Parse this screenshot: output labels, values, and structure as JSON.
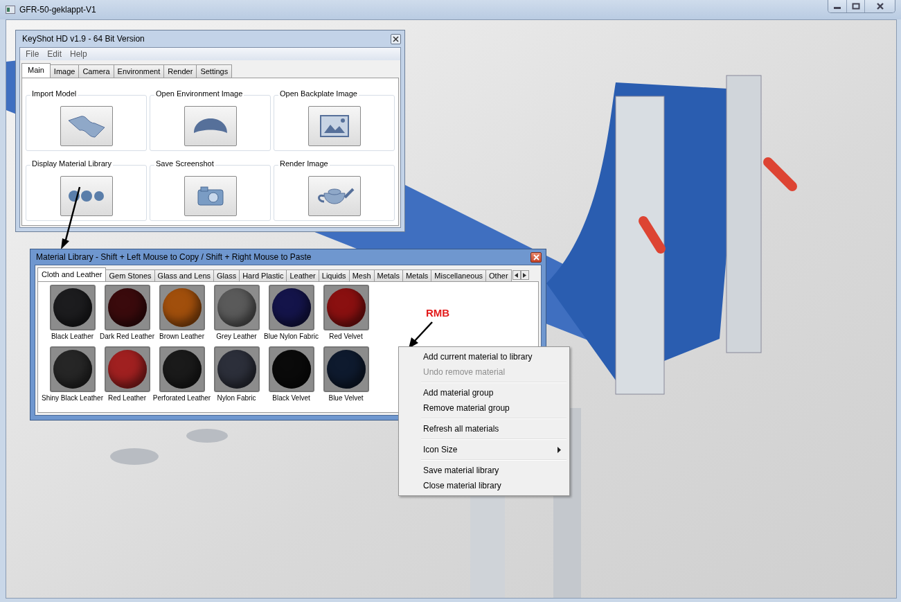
{
  "window": {
    "title": "GFR-50-geklappt-V1"
  },
  "keyshot_window": {
    "title": "KeyShot HD v1.9 - 64 Bit Version",
    "menu": [
      "File",
      "Edit",
      "Help"
    ],
    "tabs": [
      {
        "label": "Main",
        "selected": true
      },
      {
        "label": "Image",
        "selected": false
      },
      {
        "label": "Camera",
        "selected": false
      },
      {
        "label": "Environment",
        "selected": false
      },
      {
        "label": "Render",
        "selected": false
      },
      {
        "label": "Settings",
        "selected": false
      }
    ],
    "actions": [
      {
        "label": "Import Model",
        "kind": "surface"
      },
      {
        "label": "Open Environment Image",
        "kind": "dome"
      },
      {
        "label": "Open Backplate Image",
        "kind": "picture"
      },
      {
        "label": "Display Material Library",
        "kind": "spheres"
      },
      {
        "label": "Save Screenshot",
        "kind": "camera"
      },
      {
        "label": "Render Image",
        "kind": "teapot"
      }
    ]
  },
  "material_library": {
    "title": "Material Library - Shift + Left Mouse to Copy / Shift + Right Mouse to Paste",
    "tabs": [
      {
        "label": "Cloth and Leather",
        "selected": true
      },
      {
        "label": "Gem Stones",
        "selected": false
      },
      {
        "label": "Glass and Lens",
        "selected": false
      },
      {
        "label": "Glass",
        "selected": false
      },
      {
        "label": "Hard Plastic",
        "selected": false
      },
      {
        "label": "Leather",
        "selected": false
      },
      {
        "label": "Liquids",
        "selected": false
      },
      {
        "label": "Mesh",
        "selected": false
      },
      {
        "label": "Metals",
        "selected": false
      },
      {
        "label": "Metals",
        "selected": false
      },
      {
        "label": "Miscellaneous",
        "selected": false
      },
      {
        "label": "Other",
        "selected": false
      }
    ],
    "materials": [
      {
        "name": "Black Leather",
        "color": "#1c1c1e"
      },
      {
        "name": "Dark Red Leather",
        "color": "#3a0a0c"
      },
      {
        "name": "Brown Leather",
        "color": "#a14f0c"
      },
      {
        "name": "Grey Leather",
        "color": "#5a5a5a"
      },
      {
        "name": "Blue Nylon Fabric",
        "color": "#14144a"
      },
      {
        "name": "Red Velvet",
        "color": "#8a1010"
      },
      {
        "name": "Shiny Black Leather",
        "color": "#262626"
      },
      {
        "name": "Red Leather",
        "color": "#a02020"
      },
      {
        "name": "Perforated Leather",
        "color": "#1a1a1a"
      },
      {
        "name": "Nylon Fabric",
        "color": "#2c2f3a"
      },
      {
        "name": "Black Velvet",
        "color": "#0a0a0a"
      },
      {
        "name": "Blue Velvet",
        "color": "#0e1a2e"
      }
    ]
  },
  "annotation": "RMB",
  "context_menu": {
    "groups": [
      [
        {
          "label": "Add current material to library",
          "disabled": false,
          "submenu": false
        },
        {
          "label": "Undo remove material",
          "disabled": true,
          "submenu": false
        }
      ],
      [
        {
          "label": "Add material group",
          "disabled": false,
          "submenu": false
        },
        {
          "label": "Remove material group",
          "disabled": false,
          "submenu": false
        }
      ],
      [
        {
          "label": "Refresh all materials",
          "disabled": false,
          "submenu": false
        }
      ],
      [
        {
          "label": "Icon Size",
          "disabled": false,
          "submenu": true
        }
      ],
      [
        {
          "label": "Save material library",
          "disabled": false,
          "submenu": false
        },
        {
          "label": "Close material library",
          "disabled": false,
          "submenu": false
        }
      ]
    ]
  }
}
